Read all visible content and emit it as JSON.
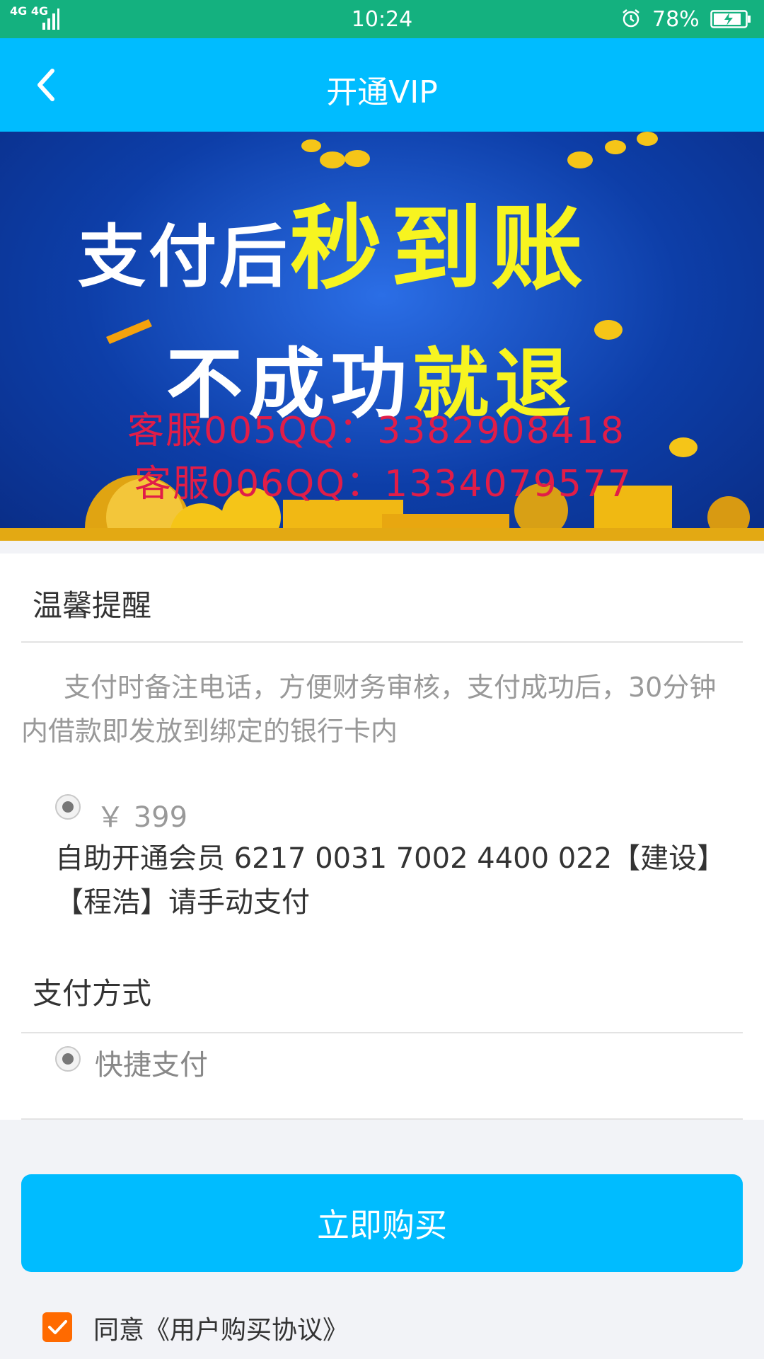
{
  "status_bar": {
    "network": "4G 4G",
    "time": "10:24",
    "battery": "78%"
  },
  "nav": {
    "title": "开通VIP"
  },
  "banner": {
    "line1_white": "支付后",
    "line1_yellow": "秒到账",
    "line2_white": "不成功",
    "line2_yellow": "就退",
    "contact1": "客服005QQ：3382908418",
    "contact2": "客服006QQ：1334079577"
  },
  "reminder": {
    "heading": "温馨提醒",
    "text": "支付时备注电话，方便财务审核，支付成功后，30分钟内借款即发放到绑定的银行卡内"
  },
  "plan": {
    "price": "￥ 399",
    "description": "自助开通会员 6217 0031 7002 4400 022【建设】【程浩】请手动支付"
  },
  "payment": {
    "heading": "支付方式",
    "option": "快捷支付"
  },
  "actions": {
    "buy_label": "立即购买",
    "agree_text": "同意《用户购买协议》"
  },
  "colors": {
    "status_bar": "#14b17f",
    "nav_bar": "#00bcff",
    "button": "#00bcff",
    "checkbox": "#ff6a00"
  }
}
